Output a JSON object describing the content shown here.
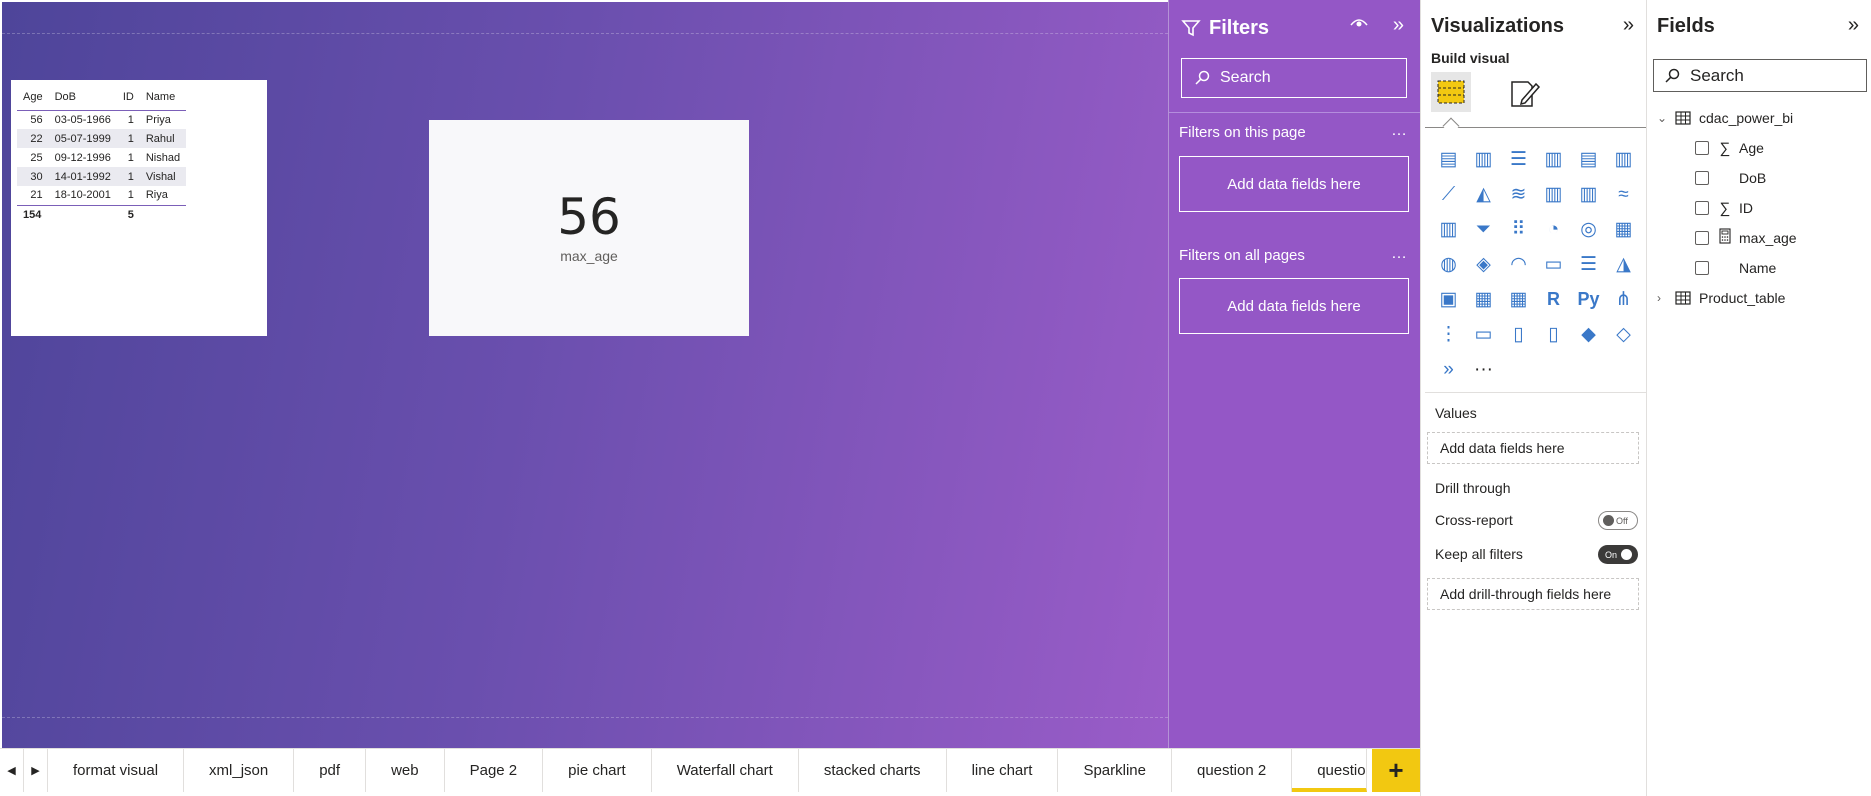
{
  "canvas": {
    "table_visual": {
      "headers": [
        "Age",
        "DoB",
        "ID",
        "Name"
      ],
      "rows": [
        {
          "age": "56",
          "dob": "03-05-1966",
          "id": "1",
          "name": "Priya"
        },
        {
          "age": "22",
          "dob": "05-07-1999",
          "id": "1",
          "name": "Rahul"
        },
        {
          "age": "25",
          "dob": "09-12-1996",
          "id": "1",
          "name": "Nishad"
        },
        {
          "age": "30",
          "dob": "14-01-1992",
          "id": "1",
          "name": "Vishal"
        },
        {
          "age": "21",
          "dob": "18-10-2001",
          "id": "1",
          "name": "Riya"
        }
      ],
      "total": {
        "age": "154",
        "dob": "",
        "id": "5",
        "name": ""
      }
    },
    "card_visual": {
      "value": "56",
      "label": "max_age"
    }
  },
  "page_tabs": {
    "tabs": [
      "format visual",
      "xml_json",
      "pdf",
      "web",
      "Page 2",
      "pie chart",
      "Waterfall chart",
      "stacked charts",
      "line chart",
      "Sparkline",
      "question 2",
      "question"
    ],
    "active_index": 11,
    "add_label": "+"
  },
  "filters": {
    "title": "Filters",
    "search_placeholder": "Search",
    "on_this_page": "Filters on this page",
    "on_all_pages": "Filters on all pages",
    "drop_label": "Add data fields here",
    "more": "…"
  },
  "visualizations": {
    "title": "Visualizations",
    "build_visual": "Build visual",
    "values_label": "Values",
    "values_drop": "Add data fields here",
    "drill_through": "Drill through",
    "cross_report": "Cross-report",
    "cross_report_state": "Off",
    "keep_all_filters": "Keep all filters",
    "keep_all_filters_state": "On",
    "drill_drop": "Add drill-through fields here",
    "more_visuals": "···",
    "icons": [
      "stacked-bar-chart-icon",
      "stacked-column-chart-icon",
      "clustered-bar-chart-icon",
      "clustered-column-chart-icon",
      "100-stacked-bar-chart-icon",
      "100-stacked-column-chart-icon",
      "line-chart-icon",
      "area-chart-icon",
      "stacked-area-chart-icon",
      "line-and-stacked-column-chart-icon",
      "line-and-clustered-column-chart-icon",
      "ribbon-chart-icon",
      "waterfall-chart-icon",
      "funnel-chart-icon",
      "scatter-chart-icon",
      "pie-chart-icon",
      "donut-chart-icon",
      "treemap-icon",
      "map-icon",
      "filled-map-icon",
      "gauge-icon",
      "card-icon",
      "multi-row-card-icon",
      "kpi-icon",
      "slicer-icon",
      "table-icon",
      "matrix-icon",
      "r-visual-icon",
      "python-visual-icon",
      "key-influencers-icon",
      "decomposition-tree-icon",
      "qa-icon",
      "smart-narrative-icon",
      "paginated-report-icon",
      "azure-map-icon",
      "power-apps-icon",
      "power-automate-icon"
    ],
    "colors": {
      "accent": "#f2c811",
      "icon_blue": "#3a78c8"
    }
  },
  "fields": {
    "title": "Fields",
    "search_placeholder": "Search",
    "tables": [
      {
        "name": "cdac_power_bi",
        "expanded": true,
        "fields": [
          {
            "name": "Age",
            "icon": "sigma-icon",
            "glyph": "∑"
          },
          {
            "name": "DoB",
            "icon": "",
            "glyph": ""
          },
          {
            "name": "ID",
            "icon": "sigma-icon",
            "glyph": "∑"
          },
          {
            "name": "max_age",
            "icon": "calculator-icon",
            "glyph": ""
          },
          {
            "name": "Name",
            "icon": "",
            "glyph": ""
          }
        ]
      },
      {
        "name": "Product_table",
        "expanded": false,
        "fields": []
      }
    ]
  },
  "theme": {
    "canvas_gradient_start": "#4e459a",
    "canvas_gradient_end": "#9a5cc8",
    "filters_bg": "#9457c6",
    "tab_accent": "#f2c811"
  }
}
